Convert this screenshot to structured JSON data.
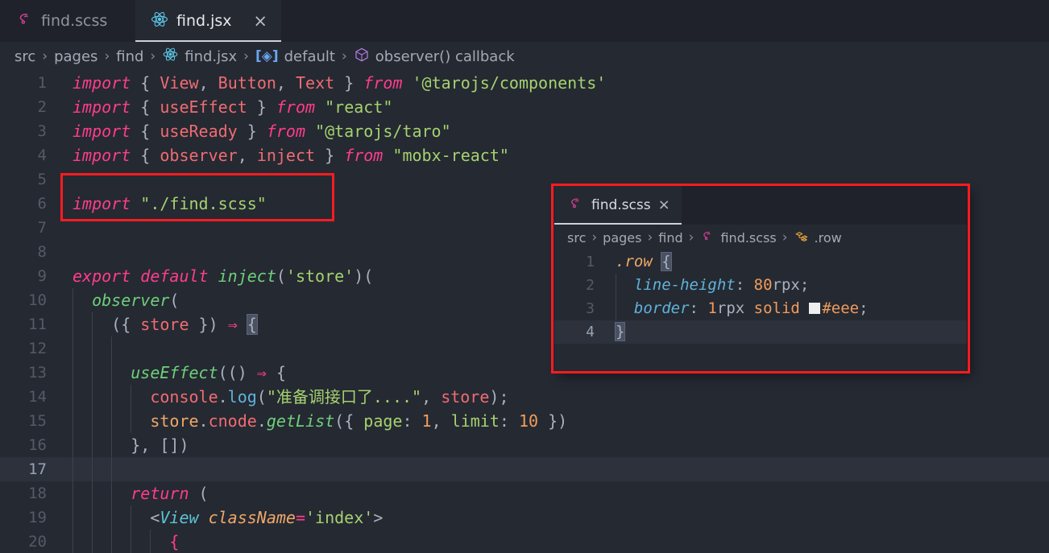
{
  "window": {
    "background": "#252932",
    "accent": "#fa1c20"
  },
  "tabbar": {
    "tabs": [
      {
        "label": "find.scss",
        "icon": "sass-icon",
        "active": false,
        "closable": false
      },
      {
        "label": "find.jsx",
        "icon": "react-icon",
        "active": true,
        "closable": true,
        "close_label": "×"
      }
    ]
  },
  "breadcrumb": {
    "separator": "›",
    "items": [
      {
        "label": "src",
        "icon": ""
      },
      {
        "label": "pages",
        "icon": ""
      },
      {
        "label": "find",
        "icon": ""
      },
      {
        "label": "find.jsx",
        "icon": "react-icon"
      },
      {
        "label": "default",
        "icon": "export-default-icon"
      },
      {
        "label": "observer() callback",
        "icon": "cube-icon"
      }
    ]
  },
  "editor": {
    "active_line": 17,
    "lines": [
      {
        "n": 1,
        "indent_guides": 0,
        "tokens": [
          {
            "t": "import",
            "c": "kw"
          },
          {
            "t": " ",
            "c": "pun"
          },
          {
            "t": "{ ",
            "c": "pun"
          },
          {
            "t": "View",
            "c": "var"
          },
          {
            "t": ", ",
            "c": "pun"
          },
          {
            "t": "Button",
            "c": "var"
          },
          {
            "t": ", ",
            "c": "pun"
          },
          {
            "t": "Text",
            "c": "var"
          },
          {
            "t": " } ",
            "c": "pun"
          },
          {
            "t": "from",
            "c": "kw"
          },
          {
            "t": " ",
            "c": "pun"
          },
          {
            "t": "'@tarojs/components'",
            "c": "str"
          }
        ]
      },
      {
        "n": 2,
        "indent_guides": 0,
        "tokens": [
          {
            "t": "import",
            "c": "kw"
          },
          {
            "t": " ",
            "c": "pun"
          },
          {
            "t": "{ ",
            "c": "pun"
          },
          {
            "t": "useEffect",
            "c": "var"
          },
          {
            "t": " } ",
            "c": "pun"
          },
          {
            "t": "from",
            "c": "kw"
          },
          {
            "t": " ",
            "c": "pun"
          },
          {
            "t": "\"react\"",
            "c": "str"
          }
        ]
      },
      {
        "n": 3,
        "indent_guides": 0,
        "tokens": [
          {
            "t": "import",
            "c": "kw"
          },
          {
            "t": " ",
            "c": "pun"
          },
          {
            "t": "{ ",
            "c": "pun"
          },
          {
            "t": "useReady",
            "c": "var"
          },
          {
            "t": " } ",
            "c": "pun"
          },
          {
            "t": "from",
            "c": "kw"
          },
          {
            "t": " ",
            "c": "pun"
          },
          {
            "t": "\"@tarojs/taro\"",
            "c": "str"
          }
        ]
      },
      {
        "n": 4,
        "indent_guides": 0,
        "tokens": [
          {
            "t": "import",
            "c": "kw"
          },
          {
            "t": " ",
            "c": "pun"
          },
          {
            "t": "{ ",
            "c": "pun"
          },
          {
            "t": "observer",
            "c": "var"
          },
          {
            "t": ", ",
            "c": "pun"
          },
          {
            "t": "inject",
            "c": "var"
          },
          {
            "t": " } ",
            "c": "pun"
          },
          {
            "t": "from",
            "c": "kw"
          },
          {
            "t": " ",
            "c": "pun"
          },
          {
            "t": "\"mobx-react\"",
            "c": "str"
          }
        ]
      },
      {
        "n": 5,
        "indent_guides": 0,
        "tokens": []
      },
      {
        "n": 6,
        "indent_guides": 0,
        "tokens": [
          {
            "t": "import",
            "c": "kw"
          },
          {
            "t": " ",
            "c": "pun"
          },
          {
            "t": "\"./find.scss\"",
            "c": "str"
          }
        ]
      },
      {
        "n": 7,
        "indent_guides": 0,
        "tokens": []
      },
      {
        "n": 8,
        "indent_guides": 0,
        "tokens": []
      },
      {
        "n": 9,
        "indent_guides": 0,
        "tokens": [
          {
            "t": "export",
            "c": "kw"
          },
          {
            "t": " ",
            "c": "pun"
          },
          {
            "t": "default",
            "c": "kw"
          },
          {
            "t": " ",
            "c": "pun"
          },
          {
            "t": "inject",
            "c": "fn"
          },
          {
            "t": "(",
            "c": "pun"
          },
          {
            "t": "'store'",
            "c": "str"
          },
          {
            "t": ")(",
            "c": "pun"
          }
        ]
      },
      {
        "n": 10,
        "indent_guides": 1,
        "tokens": [
          {
            "t": "  ",
            "c": "pun"
          },
          {
            "t": "observer",
            "c": "fn"
          },
          {
            "t": "(",
            "c": "pun"
          }
        ]
      },
      {
        "n": 11,
        "indent_guides": 2,
        "tokens": [
          {
            "t": "    ",
            "c": "pun"
          },
          {
            "t": "({ ",
            "c": "pun"
          },
          {
            "t": "store",
            "c": "var"
          },
          {
            "t": " }) ",
            "c": "pun"
          },
          {
            "t": "⇒",
            "c": "op"
          },
          {
            "t": " ",
            "c": "pun"
          },
          {
            "t": "{",
            "c": "pun brmatch"
          }
        ]
      },
      {
        "n": 12,
        "indent_guides": 3,
        "tokens": []
      },
      {
        "n": 13,
        "indent_guides": 3,
        "tokens": [
          {
            "t": "      ",
            "c": "pun"
          },
          {
            "t": "useEffect",
            "c": "fn"
          },
          {
            "t": "(() ",
            "c": "pun"
          },
          {
            "t": "⇒",
            "c": "op"
          },
          {
            "t": " {",
            "c": "pun"
          }
        ]
      },
      {
        "n": 14,
        "indent_guides": 4,
        "tokens": [
          {
            "t": "        ",
            "c": "pun"
          },
          {
            "t": "console",
            "c": "var"
          },
          {
            "t": ".",
            "c": "pun"
          },
          {
            "t": "log",
            "c": "prop"
          },
          {
            "t": "(",
            "c": "pun"
          },
          {
            "t": "\"准备调接口了....\"",
            "c": "str"
          },
          {
            "t": ", ",
            "c": "pun"
          },
          {
            "t": "store",
            "c": "var"
          },
          {
            "t": ");",
            "c": "pun"
          }
        ]
      },
      {
        "n": 15,
        "indent_guides": 4,
        "tokens": [
          {
            "t": "        ",
            "c": "pun"
          },
          {
            "t": "store",
            "c": "obj"
          },
          {
            "t": ".",
            "c": "pun"
          },
          {
            "t": "cnode",
            "c": "var"
          },
          {
            "t": ".",
            "c": "pun"
          },
          {
            "t": "getList",
            "c": "fn"
          },
          {
            "t": "({ ",
            "c": "pun"
          },
          {
            "t": "page",
            "c": "str"
          },
          {
            "t": ": ",
            "c": "pun"
          },
          {
            "t": "1",
            "c": "num"
          },
          {
            "t": ", ",
            "c": "pun"
          },
          {
            "t": "limit",
            "c": "str"
          },
          {
            "t": ": ",
            "c": "pun"
          },
          {
            "t": "10",
            "c": "num"
          },
          {
            "t": " })",
            "c": "pun"
          }
        ]
      },
      {
        "n": 16,
        "indent_guides": 3,
        "tokens": [
          {
            "t": "      ",
            "c": "pun"
          },
          {
            "t": "}, [])",
            "c": "pun"
          }
        ]
      },
      {
        "n": 17,
        "indent_guides": 3,
        "tokens": []
      },
      {
        "n": 18,
        "indent_guides": 3,
        "tokens": [
          {
            "t": "      ",
            "c": "pun"
          },
          {
            "t": "return",
            "c": "kw"
          },
          {
            "t": " (",
            "c": "pun"
          }
        ]
      },
      {
        "n": 19,
        "indent_guides": 4,
        "tokens": [
          {
            "t": "        ",
            "c": "pun"
          },
          {
            "t": "<",
            "c": "pun"
          },
          {
            "t": "View",
            "c": "tag"
          },
          {
            "t": " ",
            "c": "pun"
          },
          {
            "t": "className",
            "c": "attr"
          },
          {
            "t": "=",
            "c": "op"
          },
          {
            "t": "'index'",
            "c": "str"
          },
          {
            "t": ">",
            "c": "pun"
          }
        ]
      },
      {
        "n": 20,
        "indent_guides": 5,
        "tokens": [
          {
            "t": "          ",
            "c": "pun"
          },
          {
            "t": "{",
            "c": "op"
          }
        ]
      }
    ]
  },
  "peek_panel": {
    "tab": {
      "label": "find.scss",
      "icon": "sass-icon",
      "close_label": "×"
    },
    "breadcrumb": {
      "separator": "›",
      "items": [
        {
          "label": "src",
          "icon": ""
        },
        {
          "label": "pages",
          "icon": ""
        },
        {
          "label": "find",
          "icon": ""
        },
        {
          "label": "find.scss",
          "icon": "sass-icon"
        },
        {
          "label": ".row",
          "icon": "css-rule-icon"
        }
      ]
    },
    "active_line": 4,
    "lines": [
      {
        "n": 1,
        "indent_guides": 0,
        "tokens": [
          {
            "t": ".row",
            "c": "sel-cls"
          },
          {
            "t": " ",
            "c": "pun"
          },
          {
            "t": "{",
            "c": "pun brmatch"
          }
        ]
      },
      {
        "n": 2,
        "indent_guides": 1,
        "tokens": [
          {
            "t": "  ",
            "c": "pun"
          },
          {
            "t": "line-height",
            "c": "css-prop"
          },
          {
            "t": ": ",
            "c": "pun"
          },
          {
            "t": "80",
            "c": "num"
          },
          {
            "t": "rpx",
            "c": "pun"
          },
          {
            "t": ";",
            "c": "pun"
          }
        ]
      },
      {
        "n": 3,
        "indent_guides": 1,
        "tokens": [
          {
            "t": "  ",
            "c": "pun"
          },
          {
            "t": "border",
            "c": "css-prop"
          },
          {
            "t": ": ",
            "c": "pun"
          },
          {
            "t": "1",
            "c": "num"
          },
          {
            "t": "rpx",
            "c": "pun"
          },
          {
            "t": " ",
            "c": "pun"
          },
          {
            "t": "solid",
            "c": "num"
          },
          {
            "t": " ",
            "c": "pun"
          },
          {
            "t": "#eee",
            "c": "num",
            "swatch": "#eeeeee"
          },
          {
            "t": ";",
            "c": "pun"
          }
        ]
      },
      {
        "n": 4,
        "indent_guides": 0,
        "tokens": [
          {
            "t": "}",
            "c": "pun brmatch"
          }
        ]
      }
    ]
  },
  "annotations": [
    {
      "name": "import-scss-highlight",
      "color": "#fa1c20"
    },
    {
      "name": "peek-panel-highlight",
      "color": "#fa1c20"
    }
  ]
}
